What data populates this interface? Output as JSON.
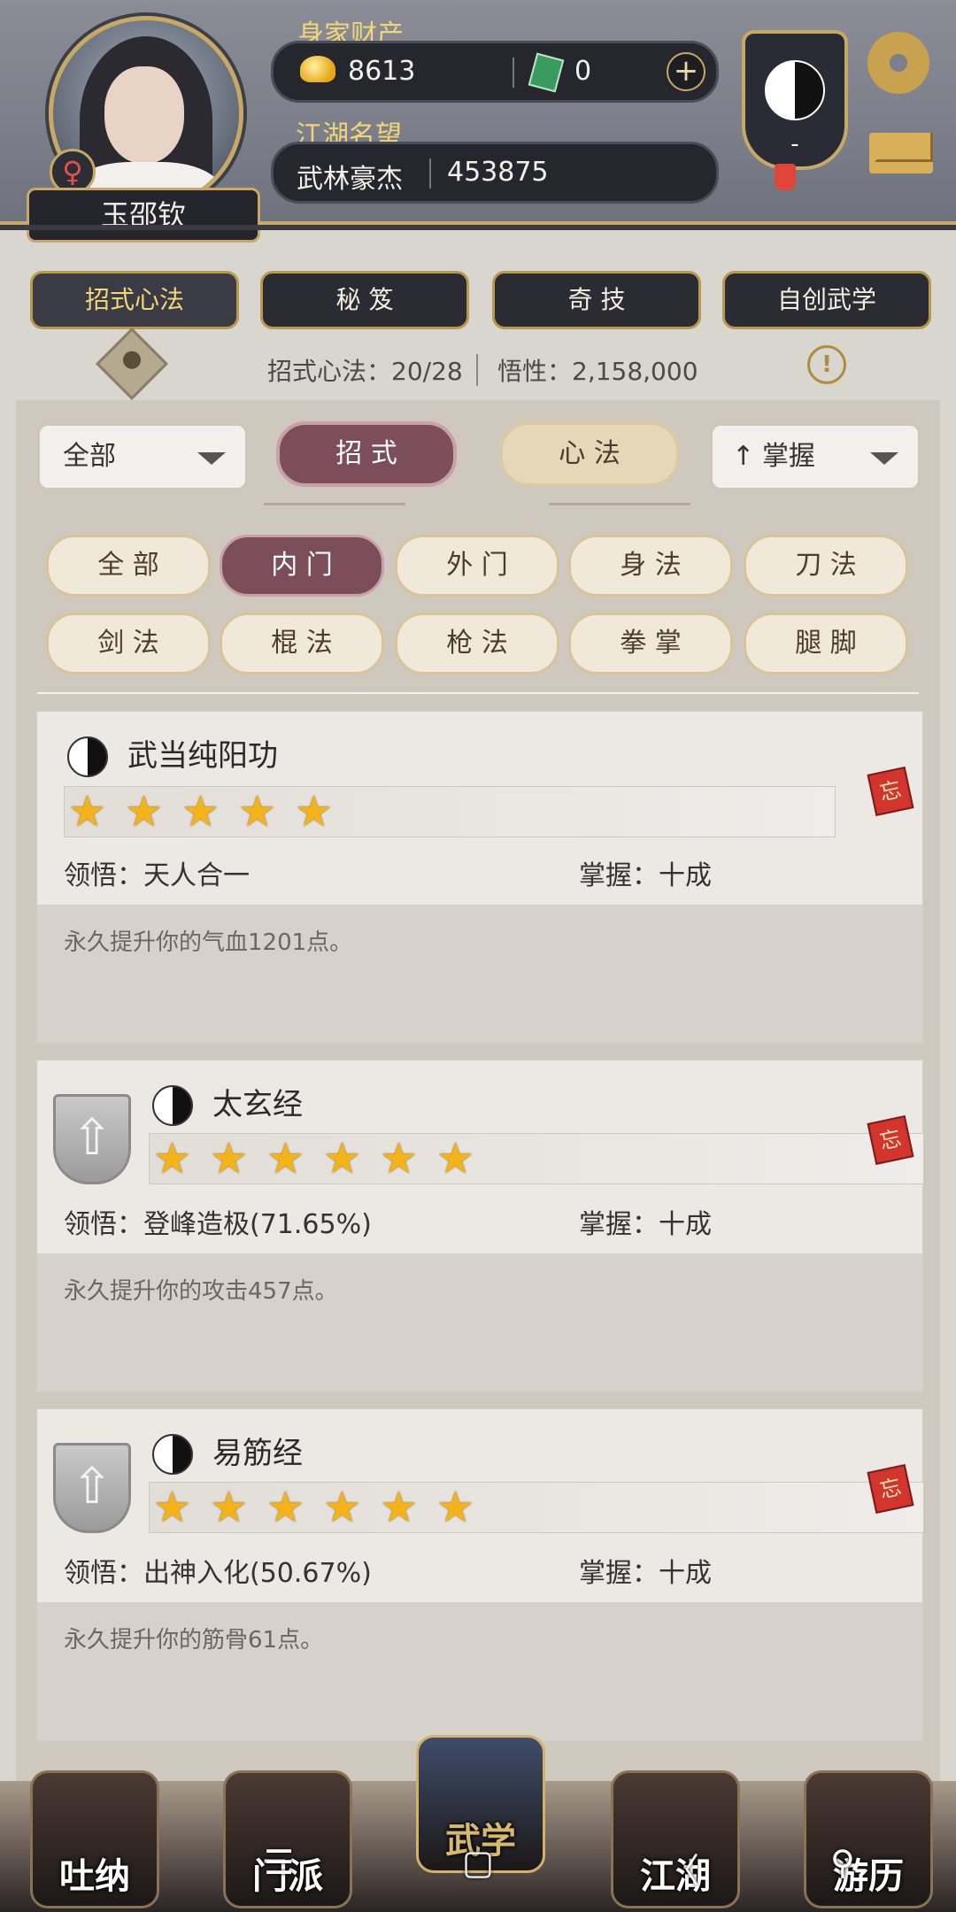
{
  "profile": {
    "name": "玉邵钦",
    "gender_symbol": "♀",
    "wealth_label": "身家财产",
    "gold": "8613",
    "jade": "0",
    "reputation_label": "江湖名望",
    "reputation_title": "武林豪杰",
    "reputation_value": "453875",
    "sect_value": "-"
  },
  "category_tabs": [
    "招式心法",
    "秘 笈",
    "奇 技",
    "自创武学"
  ],
  "summary": {
    "count_text": "招式心法：20/28",
    "comprehension_text": "悟性：2,158,000",
    "warning_symbol": "!"
  },
  "filters": {
    "left_dropdown": "全部",
    "type_tabs": [
      "招 式",
      "心 法"
    ],
    "sort_dropdown": "掌握",
    "sort_arrow": "↑",
    "chips_row1": [
      "全 部",
      "内 门",
      "外 门",
      "身 法",
      "刀 法"
    ],
    "chips_row2": [
      "剑 法",
      "棍 法",
      "枪 法",
      "拳 掌",
      "腿 脚"
    ]
  },
  "skills": [
    {
      "name": "武当纯阳功",
      "stars": 5,
      "comprehension": "领悟：天人合一",
      "mastery": "掌握：十成",
      "description": "永久提升你的气血1201点。",
      "tag": "忘"
    },
    {
      "name": "太玄经",
      "stars": 6,
      "comprehension": "领悟：登峰造极(71.65%)",
      "mastery": "掌握：十成",
      "description": "永久提升你的攻击457点。",
      "tag": "忘"
    },
    {
      "name": "易筋经",
      "stars": 6,
      "comprehension": "领悟：出神入化(50.67%)",
      "mastery": "掌握：十成",
      "description": "永久提升你的筋骨61点。",
      "tag": "忘"
    }
  ],
  "bottom_nav": [
    "吐纳",
    "门派",
    "武学",
    "江湖",
    "游历"
  ],
  "system_buttons": [
    "☰",
    "▢",
    "〈",
    "⚲"
  ],
  "colors": {
    "accent_gold": "#c7a867",
    "active_chip": "#7b4e5a",
    "star": "#f4b21b",
    "tag_red": "#d2342e"
  }
}
